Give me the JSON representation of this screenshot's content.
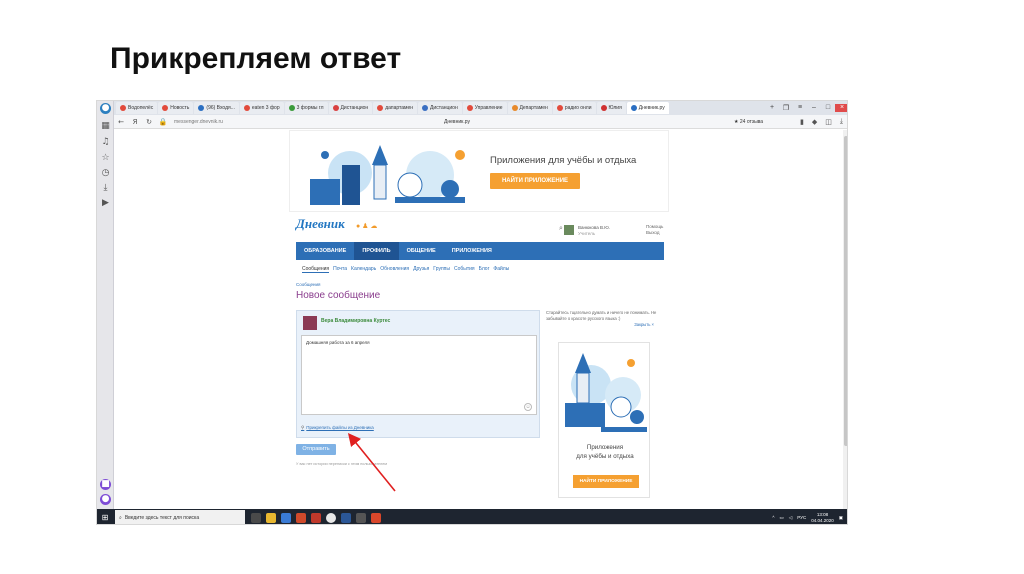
{
  "slide": {
    "title": "Прикрепляем ответ"
  },
  "browser": {
    "tabs": [
      {
        "label": "Водопелёс",
        "color": "#e24a3b"
      },
      {
        "label": "Новость",
        "color": "#e24a3b"
      },
      {
        "label": "(96) Входя...",
        "color": "#2b6fc2"
      },
      {
        "label": "eaten 3 фор",
        "color": "#e24a3b"
      },
      {
        "label": "3 формы гл",
        "color": "#3b9b3b"
      },
      {
        "label": "Дистанцион",
        "color": "#d94040"
      },
      {
        "label": "дапартамен",
        "color": "#e24a3b"
      },
      {
        "label": "Дистанцион",
        "color": "#3a6fc2"
      },
      {
        "label": "Управление",
        "color": "#e24a3b"
      },
      {
        "label": "Департамен",
        "color": "#e88a2b"
      },
      {
        "label": "радио онли",
        "color": "#e24a3b"
      },
      {
        "label": "Юлия",
        "color": "#d03030"
      },
      {
        "label": "Дневник.ру",
        "color": "#2b6fc2"
      }
    ],
    "url": "messenger.dnevnik.ru",
    "page_title": "Дневник.ру",
    "reviews": "24 отзыва"
  },
  "banner": {
    "text": "Приложения для учёбы и отдыха",
    "button": "НАЙТИ ПРИЛОЖЕНИЕ"
  },
  "site": {
    "logo": "Дневник",
    "user_name": "Ванюкова В.Ю.",
    "user_role": "Учитель",
    "logout": [
      "Помощь",
      "Выход"
    ],
    "main_nav": [
      "ОБРАЗОВАНИЕ",
      "ПРОФИЛЬ",
      "ОБЩЕНИЕ",
      "ПРИЛОЖЕНИЯ"
    ],
    "sub_nav": [
      "Сообщения",
      "Почта",
      "Календарь",
      "Обновления",
      "Друзья",
      "Группы",
      "События",
      "Блог",
      "Файлы"
    ],
    "breadcrumb": "Сообщения",
    "page_heading": "Новое сообщение",
    "recipient": "Вера Владимировна Куртес",
    "message": "Домашняя работа за 6 апреля",
    "attach_link": "Прикрепить файлы из Дневника",
    "send_button": "Отправить",
    "note": "У вас нет истории переписки с этим пользователем",
    "tip": "Старайтесь тщательно думать и ничего не понимать. Не забывайте о красоте русского языка :)",
    "tip_close": "Закрыть ×",
    "side_ad_text": [
      "Приложения",
      "для учёбы и отдыха"
    ],
    "side_ad_button": "НАЙТИ ПРИЛОЖЕНИЕ"
  },
  "taskbar": {
    "search_placeholder": "Введите здесь текст для поиска",
    "lang": "РУС",
    "time": "13:08",
    "date": "04.04.2020"
  }
}
